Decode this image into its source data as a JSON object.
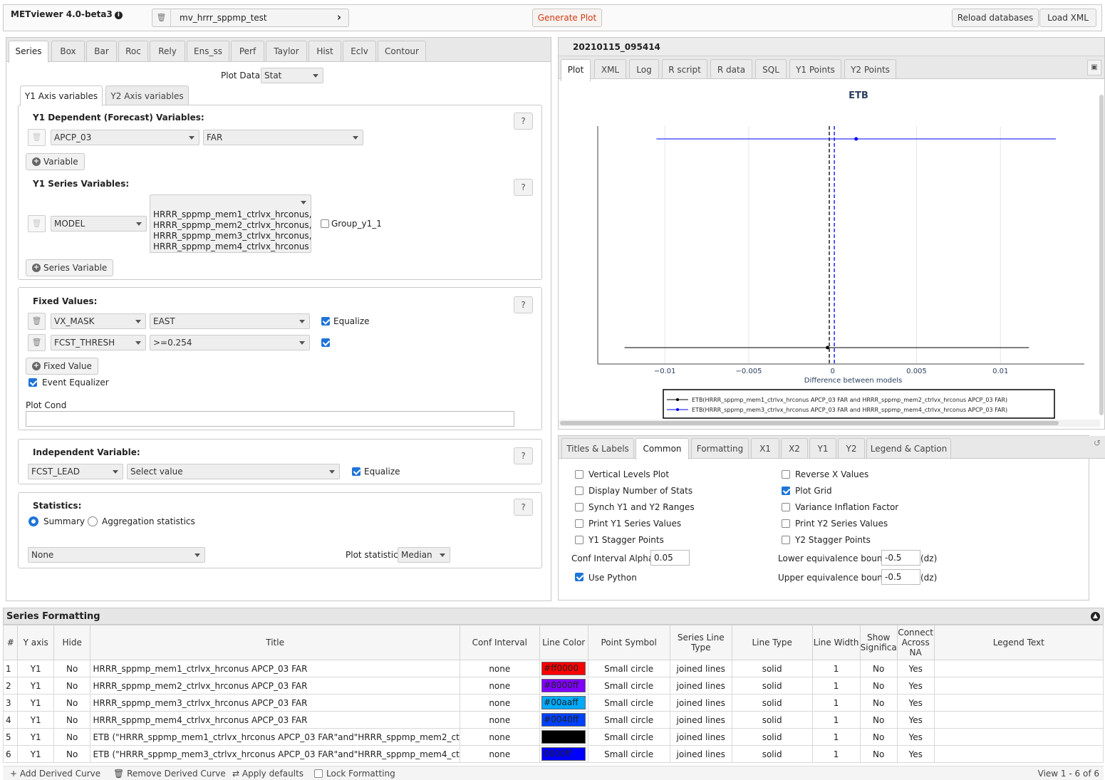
{
  "app": {
    "title": "METviewer 4.0-beta3",
    "db_name": "mv_hrrr_sppmp_test",
    "generate_label": "Generate Plot",
    "reload_label": "Reload databases",
    "load_xml_label": "Load XML"
  },
  "left_tabs": [
    "Series",
    "Box",
    "Bar",
    "Roc",
    "Rely",
    "Ens_ss",
    "Perf",
    "Taylor",
    "Hist",
    "Eclv",
    "Contour"
  ],
  "plot_data": {
    "label": "Plot Data:",
    "value": "Stat"
  },
  "axis_tabs": [
    "Y1 Axis variables",
    "Y2 Axis variables"
  ],
  "y1_dep": {
    "title": "Y1 Dependent (Forecast) Variables:",
    "var": "APCP_03",
    "stat": "FAR",
    "add_label": "Variable",
    "help": "?"
  },
  "y1_series": {
    "title": "Y1 Series Variables:",
    "var": "MODEL",
    "values": [
      "HRRR_sppmp_mem1_ctrlvx_hrconus,",
      "HRRR_sppmp_mem2_ctrlvx_hrconus,",
      "HRRR_sppmp_mem3_ctrlvx_hrconus,",
      "HRRR_sppmp_mem4_ctrlvx_hrconus"
    ],
    "group_label": "Group_y1_1",
    "add_label": "Series Variable",
    "help": "?"
  },
  "fixed": {
    "title": "Fixed Values:",
    "rows": [
      {
        "var": "VX_MASK",
        "value": "EAST",
        "equalize": "Equalize"
      },
      {
        "var": "FCST_THRESH",
        "value": ">=0.254",
        "equalize": ""
      }
    ],
    "add_label": "Fixed Value",
    "event_eq": "Event Equalizer",
    "plot_cond": "Plot Cond",
    "help": "?"
  },
  "indep": {
    "title": "Independent Variable:",
    "var": "FCST_LEAD",
    "value": "Select value",
    "equalize": "Equalize",
    "help": "?"
  },
  "stats": {
    "title": "Statistics:",
    "summary": "Summary",
    "aggregation": "Aggregation statistics",
    "none": "None",
    "plot_stat_label": "Plot statistic:",
    "plot_stat": "Median",
    "help": "?"
  },
  "right": {
    "timestamp": "20210115_095414",
    "tabs": [
      "Plot",
      "XML",
      "Log",
      "R script",
      "R data",
      "SQL",
      "Y1 Points",
      "Y2 Points"
    ]
  },
  "chart_data": {
    "type": "scatter",
    "title": "ETB",
    "xlabel": "Difference between models",
    "ylabel": "",
    "xlim": [
      -0.014,
      0.015
    ],
    "xticks": [
      "−0.01",
      "−0.005",
      "0",
      "0.005",
      "0.01"
    ],
    "xtick_values": [
      -0.01,
      -0.005,
      0,
      0.005,
      0.01
    ],
    "grid": true,
    "legend_position": "bottom",
    "series": [
      {
        "name": "ETB(HRRR_sppmp_mem1_ctrlvx_hrconus APCP_03 FAR and HRRR_sppmp_mem2_ctrlvx_hrconus APCP_03 FAR)",
        "color": "#000000",
        "y": 1,
        "x": -0.0003,
        "ci": [
          -0.0124,
          0.0117
        ]
      },
      {
        "name": "ETB(HRRR_sppmp_mem3_ctrlvx_hrconus APCP_03 FAR and HRRR_sppmp_mem4_ctrlvx_hrconus APCP_03 FAR)",
        "color": "#0000ff",
        "y": 2,
        "x": 0.0014,
        "ci": [
          -0.0105,
          0.0133
        ]
      }
    ],
    "vlines": [
      {
        "x": -0.0002,
        "color": "#000000"
      },
      {
        "x": 0.0001,
        "color": "#0000ff"
      }
    ]
  },
  "bottom_tabs": [
    "Titles & Labels",
    "Common",
    "Formatting",
    "X1",
    "X2",
    "Y1",
    "Y2",
    "Legend & Caption"
  ],
  "common": {
    "left": [
      {
        "label": "Vertical Levels Plot",
        "checked": false
      },
      {
        "label": "Display Number of Stats",
        "checked": false
      },
      {
        "label": "Synch Y1 and Y2 Ranges",
        "checked": false
      },
      {
        "label": "Print Y1 Series Values",
        "checked": false
      },
      {
        "label": "Y1 Stagger Points",
        "checked": false
      }
    ],
    "right": [
      {
        "label": "Reverse X Values",
        "checked": false
      },
      {
        "label": "Plot Grid",
        "checked": true
      },
      {
        "label": "Variance Inflation Factor",
        "checked": false
      },
      {
        "label": "Print Y2 Series Values",
        "checked": false
      },
      {
        "label": "Y2 Stagger Points",
        "checked": false
      }
    ],
    "ci_alpha_label": "Conf Interval Alpha",
    "ci_alpha": "0.05",
    "use_python": "Use Python",
    "lower_label": "Lower equivalence bound",
    "lower": "-0.5",
    "upper_label": "Upper equivalence bound",
    "upper": "-0.5",
    "dz": "(dz)"
  },
  "series_formatting": {
    "title": "Series Formatting",
    "columns": [
      "#",
      "Y axis",
      "Hide",
      "Title",
      "Conf Interval",
      "Line Color",
      "Point Symbol",
      "Series Line Type",
      "Line Type",
      "Line Width",
      "Show Significa",
      "Connect Across NA",
      "Legend Text"
    ],
    "rows": [
      {
        "n": "1",
        "axis": "Y1",
        "hide": "No",
        "title": "HRRR_sppmp_mem1_ctrlvx_hrconus APCP_03 FAR",
        "ci": "none",
        "color": "#ff0000",
        "color_text": "#ff0000",
        "symbol": "Small circle",
        "series_line": "joined lines",
        "line_type": "solid",
        "width": "1",
        "sig": "No",
        "connect": "Yes",
        "legend": ""
      },
      {
        "n": "2",
        "axis": "Y1",
        "hide": "No",
        "title": "HRRR_sppmp_mem2_ctrlvx_hrconus APCP_03 FAR",
        "ci": "none",
        "color": "#8000ff",
        "color_text": "#8000ff",
        "symbol": "Small circle",
        "series_line": "joined lines",
        "line_type": "solid",
        "width": "1",
        "sig": "No",
        "connect": "Yes",
        "legend": ""
      },
      {
        "n": "3",
        "axis": "Y1",
        "hide": "No",
        "title": "HRRR_sppmp_mem3_ctrlvx_hrconus APCP_03 FAR",
        "ci": "none",
        "color": "#00aaff",
        "color_text": "#00aaff",
        "symbol": "Small circle",
        "series_line": "joined lines",
        "line_type": "solid",
        "width": "1",
        "sig": "No",
        "connect": "Yes",
        "legend": ""
      },
      {
        "n": "4",
        "axis": "Y1",
        "hide": "No",
        "title": "HRRR_sppmp_mem4_ctrlvx_hrconus APCP_03 FAR",
        "ci": "none",
        "color": "#0040ff",
        "color_text": "#0040ff",
        "symbol": "Small circle",
        "series_line": "joined lines",
        "line_type": "solid",
        "width": "1",
        "sig": "No",
        "connect": "Yes",
        "legend": ""
      },
      {
        "n": "5",
        "axis": "Y1",
        "hide": "No",
        "title": "ETB (\"HRRR_sppmp_mem1_ctrlvx_hrconus APCP_03 FAR\"and\"HRRR_sppmp_mem2_ct",
        "ci": "none",
        "color": "#000000",
        "color_text": "",
        "symbol": "Small circle",
        "series_line": "joined lines",
        "line_type": "solid",
        "width": "1",
        "sig": "No",
        "connect": "Yes",
        "legend": ""
      },
      {
        "n": "6",
        "axis": "Y1",
        "hide": "No",
        "title": "ETB (\"HRRR_sppmp_mem3_ctrlvx_hrconus APCP_03 FAR\"and\"HRRR_sppmp_mem4_ct",
        "ci": "none",
        "color": "#0000ff",
        "color_text": "0000ff",
        "symbol": "Small circle",
        "series_line": "joined lines",
        "line_type": "solid",
        "width": "1",
        "sig": "No",
        "connect": "Yes",
        "legend": ""
      }
    ]
  },
  "footer": {
    "add_derived": "Add Derived Curve",
    "remove_derived": "Remove Derived Curve",
    "apply_defaults": "Apply defaults",
    "lock": "Lock Formatting",
    "view": "View 1 - 6 of 6"
  }
}
